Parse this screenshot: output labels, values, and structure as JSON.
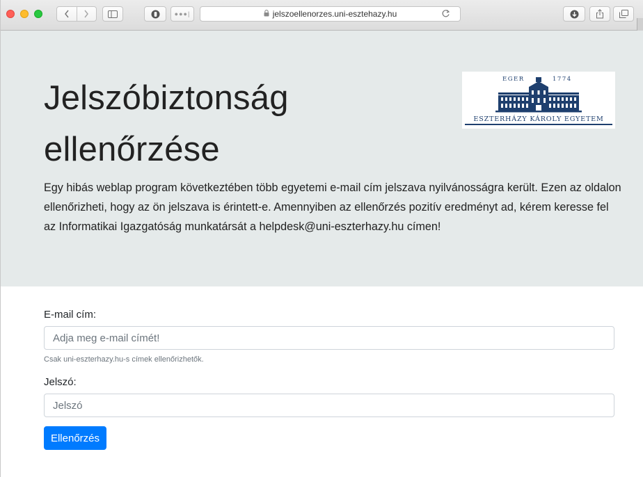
{
  "browser": {
    "url": "jelszoellenorzes.uni-esztehazy.hu",
    "icons": {
      "back": "chevron-left-icon",
      "forward": "chevron-right-icon",
      "sidebar": "sidebar-icon",
      "reader": "reader-icon",
      "extensions": "more-dots-icon",
      "lock": "lock-icon",
      "reload": "reload-icon",
      "download": "download-icon",
      "share": "share-icon",
      "tabs": "tabs-icon"
    }
  },
  "hero": {
    "title_line1": "Jelszóbiztonság",
    "title_line2": "ellenőrzése",
    "intro": "Egy hibás weblap program következtében több egyetemi e-mail cím jelszava nyilvánosságra került. Ezen az oldalon ellenőrizheti, hogy az ön jelszava is érintett-e. Amennyiben az ellenőrzés pozitív eredményt ad, kérem keresse fel az Informatikai Igazgatóság munkatársát a helpdesk@uni-eszterhazy.hu címen!",
    "logo": {
      "left_text": "EGER",
      "right_text": "1774",
      "name": "ESZTERHÁZY KÁROLY EGYETEM",
      "color": "#1e3f6e"
    }
  },
  "form": {
    "email_label": "E-mail cím:",
    "email_placeholder": "Adja meg e-mail címét!",
    "email_help": "Csak uni-eszterhazy.hu-s címek ellenőrizhetők.",
    "password_label": "Jelszó:",
    "password_placeholder": "Jelszó",
    "submit_label": "Ellenőrzés"
  },
  "colors": {
    "jumbotron_bg": "#e5eaea",
    "primary": "#007bff"
  }
}
